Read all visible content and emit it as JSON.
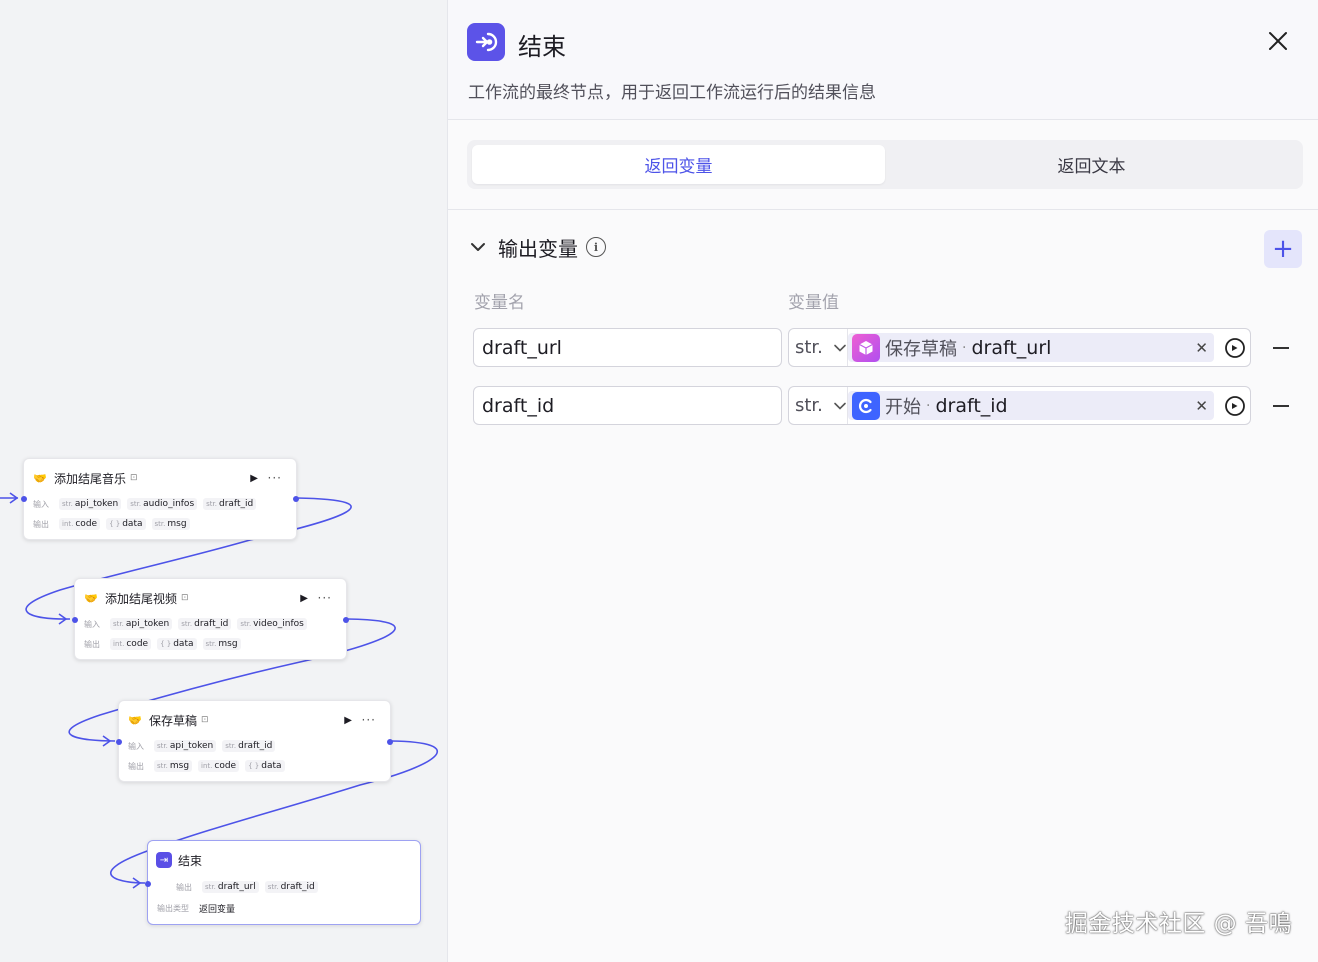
{
  "canvas": {
    "nodes": [
      {
        "title": "添加结尾音乐",
        "input_label": "输入",
        "inputs": [
          {
            "type": "str.",
            "name": "api_token"
          },
          {
            "type": "str.",
            "name": "audio_infos"
          },
          {
            "type": "str.",
            "name": "draft_id"
          }
        ],
        "output_label": "输出",
        "outputs": [
          {
            "type": "int.",
            "name": "code"
          },
          {
            "type": "{ }",
            "name": "data"
          },
          {
            "type": "str.",
            "name": "msg"
          }
        ]
      },
      {
        "title": "添加结尾视频",
        "input_label": "输入",
        "inputs": [
          {
            "type": "str.",
            "name": "api_token"
          },
          {
            "type": "str.",
            "name": "draft_id"
          },
          {
            "type": "str.",
            "name": "video_infos"
          }
        ],
        "output_label": "输出",
        "outputs": [
          {
            "type": "int.",
            "name": "code"
          },
          {
            "type": "{ }",
            "name": "data"
          },
          {
            "type": "str.",
            "name": "msg"
          }
        ]
      },
      {
        "title": "保存草稿",
        "input_label": "输入",
        "inputs": [
          {
            "type": "str.",
            "name": "api_token"
          },
          {
            "type": "str.",
            "name": "draft_id"
          }
        ],
        "output_label": "输出",
        "outputs": [
          {
            "type": "str.",
            "name": "msg"
          },
          {
            "type": "int.",
            "name": "code"
          },
          {
            "type": "{ }",
            "name": "data"
          }
        ]
      }
    ],
    "end_node": {
      "title": "结束",
      "output_label": "输出",
      "outputs": [
        {
          "type": "str.",
          "name": "draft_url"
        },
        {
          "type": "str.",
          "name": "draft_id"
        }
      ],
      "output_type_label": "输出类型",
      "output_type_value": "返回变量"
    }
  },
  "panel": {
    "title": "结束",
    "description": "工作流的最终节点，用于返回工作流运行后的结果信息",
    "tabs": [
      {
        "label": "返回变量",
        "active": true
      },
      {
        "label": "返回文本",
        "active": false
      }
    ],
    "section_title": "输出变量",
    "columns": {
      "name": "变量名",
      "value": "变量值"
    },
    "variables": [
      {
        "name": "draft_url",
        "type": "str.",
        "ref_node": "保存草稿",
        "ref_var": "draft_url",
        "icon": "cube-icon"
      },
      {
        "name": "draft_id",
        "type": "str.",
        "ref_node": "开始",
        "ref_var": "draft_id",
        "icon": "start-icon"
      }
    ]
  },
  "watermark": "掘金技术社区 @ 吾鳴",
  "colors": {
    "accent": "#4d53e8",
    "end_icon": "#5c53e8",
    "edge": "#4d53e8"
  }
}
